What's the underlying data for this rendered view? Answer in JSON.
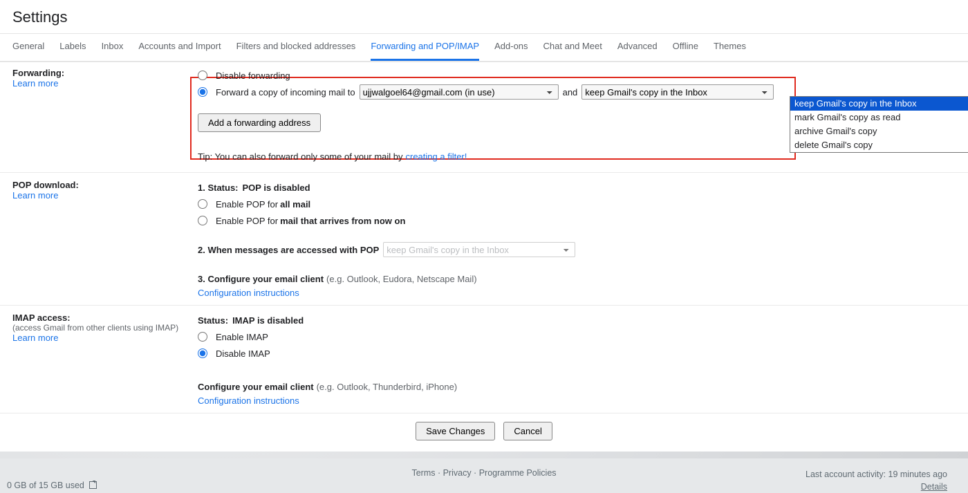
{
  "title": "Settings",
  "tabs": [
    "General",
    "Labels",
    "Inbox",
    "Accounts and Import",
    "Filters and blocked addresses",
    "Forwarding and POP/IMAP",
    "Add-ons",
    "Chat and Meet",
    "Advanced",
    "Offline",
    "Themes"
  ],
  "activeTab": 5,
  "forwarding": {
    "label": "Forwarding:",
    "learn": "Learn more",
    "disable": "Disable forwarding",
    "forward_prefix": "Forward a copy of incoming mail to",
    "address_selected": "ujjwalgoel64@gmail.com (in use)",
    "and": "and",
    "action_selected": "keep Gmail's copy in the Inbox",
    "action_options": [
      "keep Gmail's copy in the Inbox",
      "mark Gmail's copy as read",
      "archive Gmail's copy",
      "delete Gmail's copy"
    ],
    "add_btn": "Add a forwarding address",
    "tip_prefix": "Tip: You can also forward only some of your mail by ",
    "tip_link": "creating a filter!"
  },
  "pop": {
    "label": "POP download:",
    "learn": "Learn more",
    "status_1": "1. Status: ",
    "status_1b": "POP is disabled",
    "opt_all_prefix": "Enable POP for ",
    "opt_all_bold": "all mail",
    "opt_now_prefix": "Enable POP for ",
    "opt_now_bold": "mail that arrives from now on",
    "line2": "2. When messages are accessed with POP",
    "pop_action_select": "keep Gmail's copy in the Inbox",
    "line3": "3. Configure your email client ",
    "line3_grey": "(e.g. Outlook, Eudora, Netscape Mail)",
    "config_link": "Configuration instructions"
  },
  "imap": {
    "label": "IMAP access:",
    "hint": "(access Gmail from other clients using IMAP)",
    "learn": "Learn more",
    "status": "Status: ",
    "status_b": "IMAP is disabled",
    "enable": "Enable IMAP",
    "disable": "Disable IMAP",
    "config": "Configure your email client ",
    "config_grey": "(e.g. Outlook, Thunderbird, iPhone)",
    "config_link": "Configuration instructions"
  },
  "buttons": {
    "save": "Save Changes",
    "cancel": "Cancel"
  },
  "footer": {
    "terms": "Terms",
    "privacy": "Privacy",
    "policies": "Programme Policies",
    "activity": "Last account activity: 19 minutes ago",
    "details": "Details",
    "storage": "0 GB of 15 GB used"
  }
}
